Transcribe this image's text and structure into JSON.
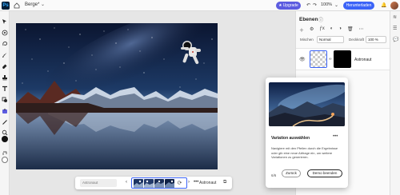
{
  "app": {
    "logo": "Ps",
    "document_title": "Berge*",
    "zoom": "100%"
  },
  "header": {
    "upgrade_label": "Upgrade",
    "share_label": "Herunterladen",
    "icons": [
      "home-icon",
      "chevron-down-icon",
      "star-icon",
      "undo-icon",
      "redo-icon",
      "zoom-chevron-icon",
      "bell-icon",
      "avatar"
    ]
  },
  "context_bar": {
    "prompt_placeholder": "Astronaut",
    "prev_label": "‹",
    "next_label": "›",
    "more_label": "•••",
    "layer_name": "Astronaut"
  },
  "layers_panel": {
    "title": "Ebenen",
    "blend_label": "Mischen",
    "blend_value": "Normal",
    "opacity_label": "Deckkraft",
    "opacity_value": "100 %",
    "layers": [
      {
        "name": "Astronaut",
        "visible": true
      }
    ]
  },
  "variation_popup": {
    "title": "Variation auswählen",
    "body": "Navigiere mit den Pfeilen durch die Ergebnisse oder gib eine neue Abfrage ein, um weitere Variationen zu generieren.",
    "step": "6/6",
    "back_label": "Zurück",
    "finish_label": "Demo beenden",
    "more_label": "•••"
  },
  "colors": {
    "accent": "#3b63f7",
    "upgrade": "#5c5ce0",
    "foreground_swatch": "#111111",
    "background_swatch": "#ffffff"
  }
}
